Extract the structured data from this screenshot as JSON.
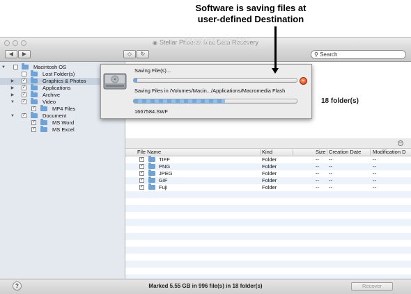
{
  "annotation": {
    "line1": "Software is saving files at",
    "line2": "user-defined Destination"
  },
  "window": {
    "title": "Stellar Phoenix Mac Data Recovery"
  },
  "toolbar": {
    "back": "◀",
    "forward": "▶",
    "view_toggle": "◇",
    "refresh": "↻",
    "search_placeholder": "Search"
  },
  "sidebar": {
    "items": [
      {
        "label": "Macintosh OS",
        "expanded": true,
        "checked": false,
        "selected": false
      },
      {
        "label": "Lost Folder(s)",
        "expanded": false,
        "checked": false,
        "selected": false
      },
      {
        "label": "Graphics & Photos",
        "expanded": false,
        "checked": true,
        "selected": true
      },
      {
        "label": "Applications",
        "expanded": false,
        "checked": true,
        "selected": false
      },
      {
        "label": "Archive",
        "expanded": false,
        "checked": true,
        "selected": false
      },
      {
        "label": "Video",
        "expanded": true,
        "checked": true,
        "selected": false
      },
      {
        "label": "MP4 Files",
        "expanded": false,
        "checked": true,
        "selected": false
      },
      {
        "label": "Document",
        "expanded": true,
        "checked": true,
        "selected": false
      },
      {
        "label": "MS Word",
        "expanded": false,
        "checked": true,
        "selected": false
      },
      {
        "label": "MS Excel",
        "expanded": false,
        "checked": true,
        "selected": false
      }
    ]
  },
  "main": {
    "hidden_title": "Macintosh OS",
    "folders_count": "18 folder(s)"
  },
  "table": {
    "columns": [
      "File Name",
      "Kind",
      "Size",
      "Creation Date",
      "Modification D"
    ],
    "rows": [
      {
        "name": "TIFF",
        "kind": "Folder",
        "size": "--",
        "created": "--",
        "modified": "--"
      },
      {
        "name": "PNG",
        "kind": "Folder",
        "size": "--",
        "created": "--",
        "modified": "--"
      },
      {
        "name": "JPEG",
        "kind": "Folder",
        "size": "--",
        "created": "--",
        "modified": "--"
      },
      {
        "name": "GIF",
        "kind": "Folder",
        "size": "--",
        "created": "--",
        "modified": "--"
      },
      {
        "name": "Fuji",
        "kind": "Folder",
        "size": "--",
        "created": "--",
        "modified": "--"
      }
    ]
  },
  "dialog": {
    "saving_label": "Saving File(s)...",
    "path_text": "Saving Files in /Volumes/Macin.../Applications/Macromedia Flash",
    "current_file": "1667584.SWF",
    "overall_progress": 0.02,
    "file_progress": 0.56
  },
  "status": {
    "help": "?",
    "summary": "Marked 5.55 GB in 996 file(s) in 18 folder(s)",
    "recover_label": "Recover"
  }
}
